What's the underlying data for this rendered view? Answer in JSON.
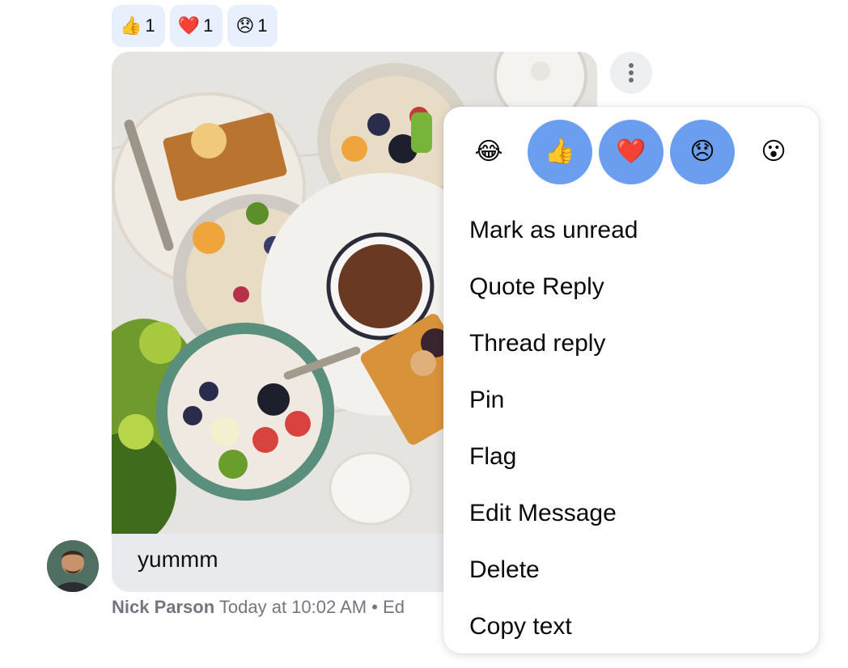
{
  "reactions": [
    {
      "emoji": "👍",
      "count": "1",
      "icon": "thumbs-up-icon"
    },
    {
      "emoji": "❤️",
      "count": "1",
      "icon": "heart-icon"
    },
    {
      "emoji": "😞",
      "count": "1",
      "icon": "disappointed-face-icon"
    }
  ],
  "message": {
    "text": "yummm",
    "author": "Nick Parson",
    "timestamp": "Today at 10:02 AM",
    "separator": "•",
    "edited_partial": "Ed"
  },
  "reaction_picker": [
    {
      "emoji": "😂",
      "icon": "joy-face-icon",
      "selected": false
    },
    {
      "emoji": "👍",
      "icon": "thumbs-up-icon",
      "selected": true
    },
    {
      "emoji": "❤️",
      "icon": "heart-icon",
      "selected": true
    },
    {
      "emoji": "😞",
      "icon": "disappointed-face-icon",
      "selected": true
    },
    {
      "emoji": "😮",
      "icon": "surprised-face-icon",
      "selected": false
    }
  ],
  "menu_items": [
    "Mark as unread",
    "Quote Reply",
    "Thread reply",
    "Pin",
    "Flag",
    "Edit Message",
    "Delete",
    "Copy text"
  ],
  "colors": {
    "reaction_bg": "#e8f0fe",
    "picker_selected": "#6c9eef",
    "bubble_bg": "#e9eaed",
    "meta_text": "#72767e"
  }
}
